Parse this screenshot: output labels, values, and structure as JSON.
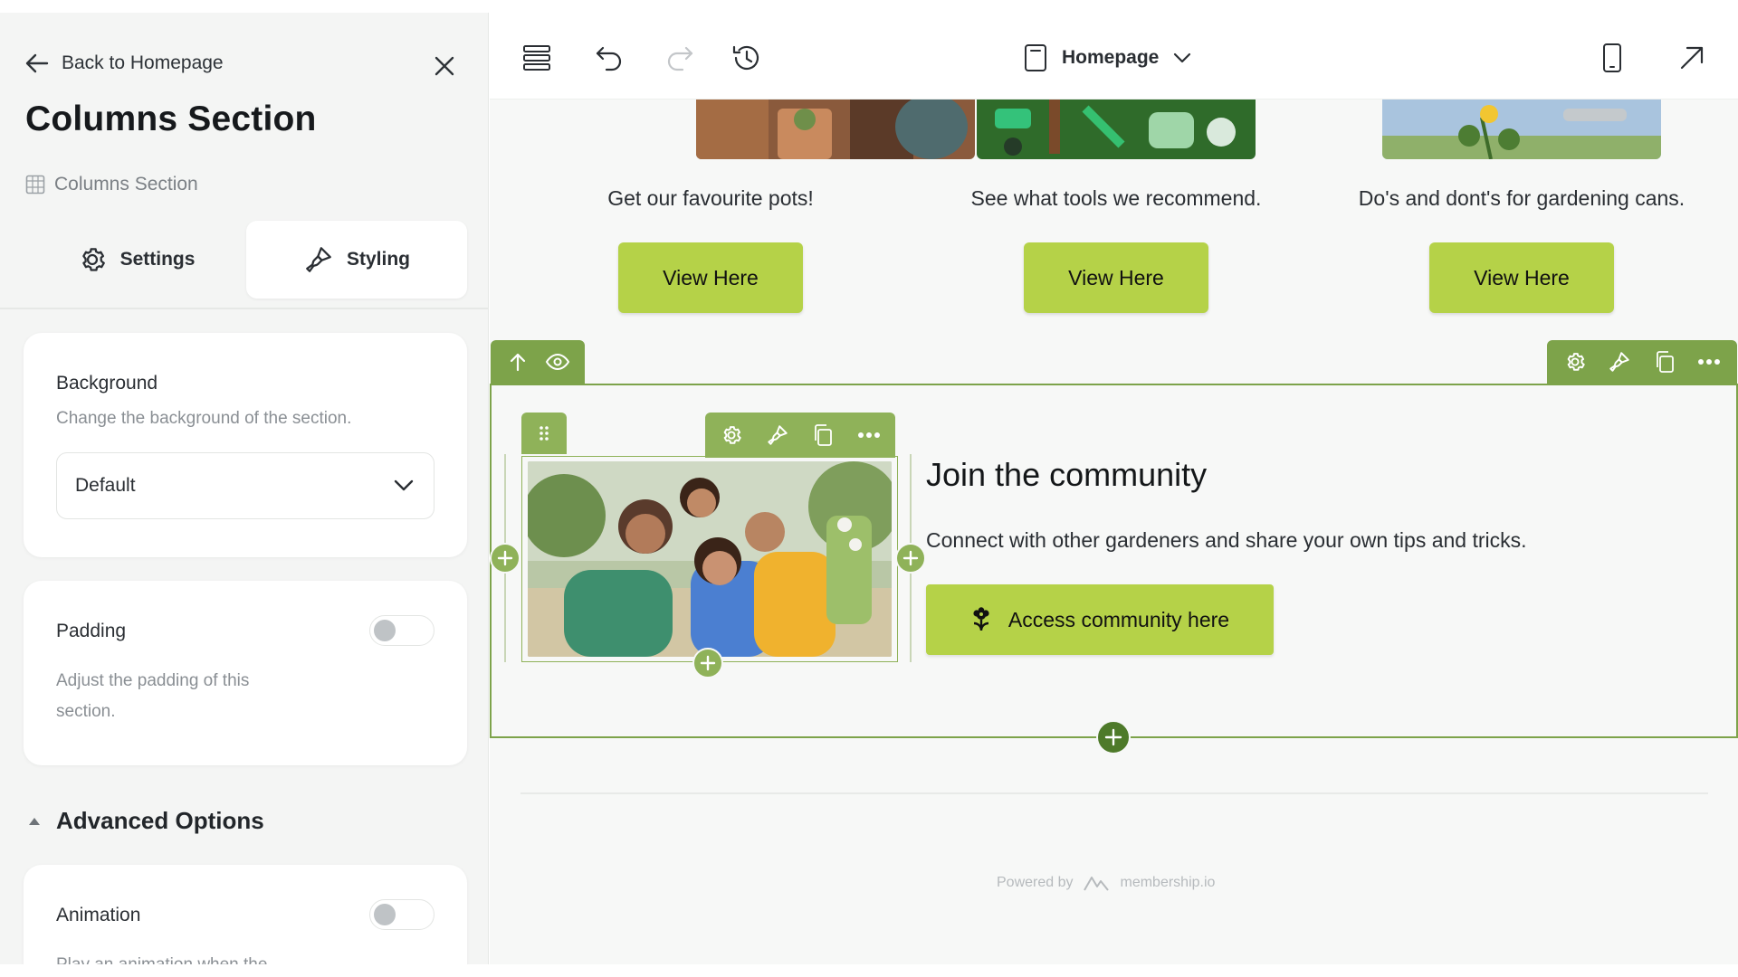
{
  "sidebar": {
    "back_label": "Back to Homepage",
    "title": "Columns Section",
    "breadcrumb": "Columns Section",
    "tabs": [
      {
        "label": "Settings",
        "icon": "gear-icon",
        "active": false
      },
      {
        "label": "Styling",
        "icon": "brush-icon",
        "active": true
      }
    ],
    "background": {
      "label": "Background",
      "description": "Change the background of the section.",
      "selected": "Default"
    },
    "padding": {
      "label": "Padding",
      "description_line1": "Adjust the padding of this",
      "description_line2": "section.",
      "enabled": false
    },
    "advanced_label": "Advanced Options",
    "animation": {
      "label": "Animation",
      "description": "Play an animation when the",
      "enabled": false
    }
  },
  "topbar": {
    "page_name": "Homepage",
    "icons": [
      "layers-icon",
      "undo-icon",
      "redo-icon",
      "history-icon",
      "mobile-preview-icon",
      "open-external-icon"
    ]
  },
  "canvas": {
    "columns": [
      {
        "text": "Get our favourite pots!",
        "button": "View Here"
      },
      {
        "text": "See what tools we recommend.",
        "button": "View Here"
      },
      {
        "text": "Do's and dont's for gardening cans.",
        "button": "View Here"
      }
    ],
    "community": {
      "heading": "Join the community",
      "text": "Connect with other gardeners and share your own tips and tricks.",
      "button": "Access community here"
    },
    "footer": {
      "powered_by": "Powered by",
      "brand": "membership.io"
    }
  },
  "colors": {
    "accent_green": "#b5d248",
    "toolbar_green": "#7da34a",
    "dark_green": "#4e7a2a"
  }
}
